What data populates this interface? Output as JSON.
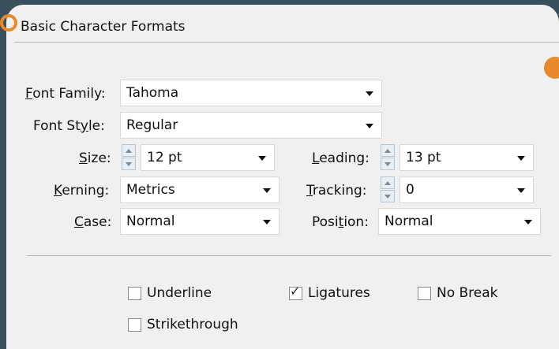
{
  "section_title": "Basic Character Formats",
  "fields": {
    "font_family": {
      "label": "Font Family:",
      "value": "Tahoma"
    },
    "font_style": {
      "label": "Font Style:",
      "value": "Regular"
    },
    "size": {
      "label": "Size:",
      "value": "12 pt"
    },
    "leading": {
      "label": "Leading:",
      "value": "13 pt"
    },
    "kerning": {
      "label": "Kerning:",
      "value": "Metrics"
    },
    "tracking": {
      "label": "Tracking:",
      "value": "0"
    },
    "case": {
      "label": "Case:",
      "value": "Normal"
    },
    "position": {
      "label": "Position:",
      "value": "Normal"
    }
  },
  "checkboxes": [
    {
      "label": "Underline",
      "checked": false
    },
    {
      "label": "Ligatures",
      "checked": true
    },
    {
      "label": "No Break",
      "checked": false
    },
    {
      "label": "Strikethrough",
      "checked": false
    }
  ],
  "colors": {
    "accent": "#e8892b",
    "background": "#39505c",
    "panel": "#f0f0f0"
  }
}
